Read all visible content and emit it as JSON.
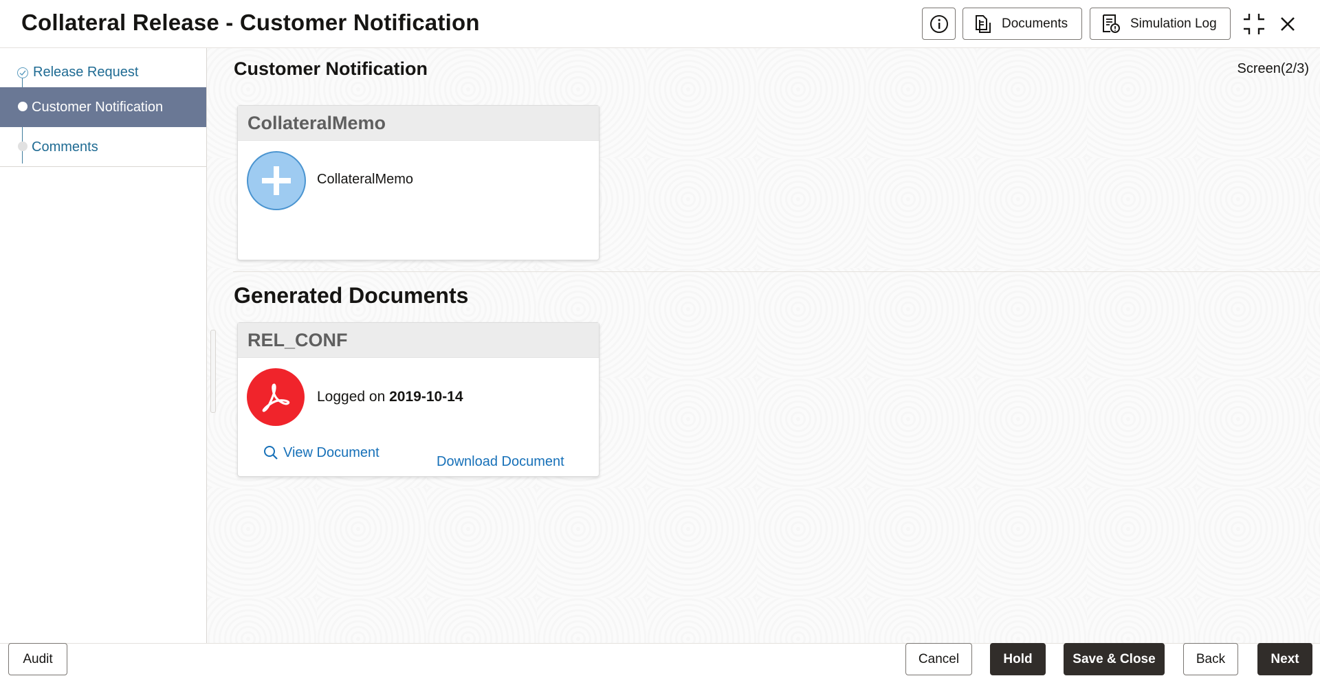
{
  "header": {
    "title": "Collateral Release - Customer Notification",
    "info_icon": "info-icon",
    "documents_label": "Documents",
    "simulation_log_label": "Simulation Log",
    "collapse_icon": "collapse-icon",
    "close_icon": "close-icon"
  },
  "sidebar": {
    "steps": [
      {
        "label": "Release Request",
        "state": "completed"
      },
      {
        "label": "Customer Notification",
        "state": "active"
      },
      {
        "label": "Comments",
        "state": "pending"
      }
    ]
  },
  "main": {
    "section_title": "Customer Notification",
    "screen_count": "Screen(2/3)",
    "memo_card": {
      "title": "CollateralMemo",
      "item_label": "CollateralMemo",
      "icon": "plus-icon"
    },
    "generated_title": "Generated Documents",
    "doc_card": {
      "title": "REL_CONF",
      "logged_prefix": "Logged on",
      "logged_date": "2019-10-14",
      "icon": "pdf-icon",
      "view_label": "View Document",
      "download_label": "Download Document"
    }
  },
  "footer": {
    "audit": "Audit",
    "cancel": "Cancel",
    "hold": "Hold",
    "save_close": "Save & Close",
    "back": "Back",
    "next": "Next"
  },
  "colors": {
    "active_step_bg": "#6a7895",
    "link": "#1670b8",
    "primary_dark": "#312d2a",
    "pdf_red": "#f0242b",
    "plus_blue": "#9ecbf1"
  }
}
